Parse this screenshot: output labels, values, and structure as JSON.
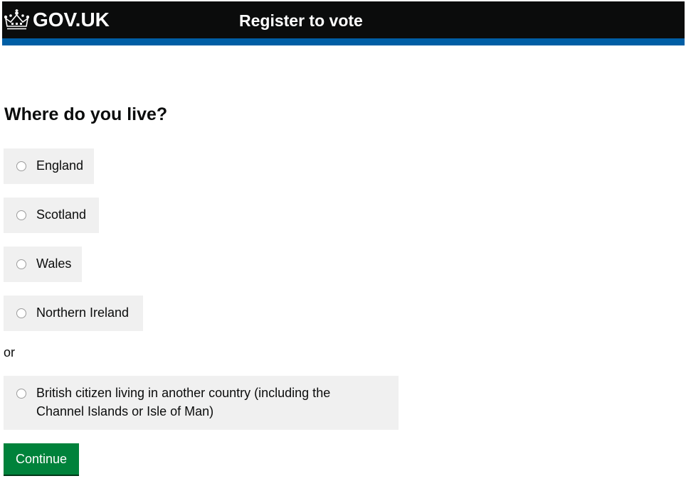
{
  "header": {
    "logo_text": "GOV.UK",
    "service_name": "Register to vote",
    "colors": {
      "background": "#0b0c0c",
      "accent_bar": "#005ea5"
    },
    "logo_icon": "crown-icon"
  },
  "form": {
    "question": "Where do you live?",
    "options": [
      {
        "label": "England",
        "selected": false
      },
      {
        "label": "Scotland",
        "selected": false
      },
      {
        "label": "Wales",
        "selected": false
      },
      {
        "label": "Northern Ireland",
        "selected": false
      }
    ],
    "separator": "or",
    "abroad_option": {
      "label_line1": "British citizen living in another country (including the",
      "label_line2": "Channel Islands or Isle of Man)",
      "selected": false
    },
    "submit_label": "Continue",
    "colors": {
      "option_background": "#f0f0f0",
      "button": "#00823b"
    }
  }
}
